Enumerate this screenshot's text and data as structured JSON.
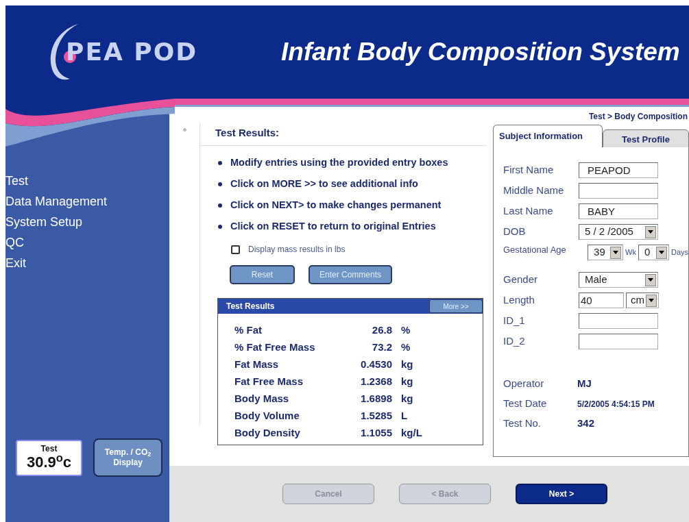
{
  "header": {
    "logo": "PEA POD",
    "title": "Infant Body Composition System"
  },
  "sidebar": {
    "items": [
      {
        "label": "Test",
        "selected": false
      },
      {
        "label": "Data Management",
        "selected": false
      },
      {
        "label": "System Setup",
        "selected": false
      },
      {
        "label": "QC",
        "selected": false
      },
      {
        "label": "Exit",
        "selected": false
      }
    ],
    "temperature": {
      "label": "Test",
      "value": "30.9$^{o}$c"
    },
    "display_button": [
      "Temp. / CO$_{2}$",
      "Display"
    ]
  },
  "breadcrumb": "Test > Body Composition",
  "section_title": "Test Results:",
  "instructions": [
    "Modify entries using the provided entry boxes",
    "Click on MORE >> to see additional info",
    "Click on NEXT> to make changes permanent",
    "Click on RESET to return to original Entries"
  ],
  "checkbox": {
    "label": "Display mass results in lbs",
    "checked": false
  },
  "action_buttons": [
    "Reset",
    "Enter Comments"
  ],
  "results": {
    "title": "Test Results",
    "more_button": "More >>",
    "rows": [
      {
        "label": "% Fat",
        "value": "26.8",
        "unit": "%"
      },
      {
        "label": "% Fat Free Mass",
        "value": "73.2",
        "unit": "%"
      },
      {
        "label": "Fat Mass",
        "value": "0.4530",
        "unit": "kg"
      },
      {
        "label": "Fat Free Mass",
        "value": "1.2368",
        "unit": "kg"
      },
      {
        "label": "Body Mass",
        "value": "1.6898",
        "unit": "kg"
      },
      {
        "label": "Body Volume",
        "value": "1.5285",
        "unit": "L"
      },
      {
        "label": "Body Density",
        "value": "1.1055",
        "unit": "kg/L"
      }
    ]
  },
  "tabs": [
    {
      "label": "Subject Information",
      "selected": true
    },
    {
      "label": "Test Profile",
      "selected": false
    }
  ],
  "fields": [
    {
      "kind": "text",
      "label": "First Name",
      "value": "PEAPOD"
    },
    {
      "kind": "text",
      "label": "Middle Name"
    },
    {
      "kind": "text",
      "label": "Last Name",
      "value": "BABY"
    },
    {
      "kind": "select",
      "label": "DOB",
      "value": "5 / 2 /2005"
    },
    {
      "kind": "age",
      "label": "Gestational Age",
      "weeks": "39",
      "weeks_unit": "Wk",
      "days": "0",
      "days_unit": "Days"
    },
    {
      "kind": "select",
      "label": "Gender",
      "value": "Male"
    },
    {
      "kind": "length",
      "label": "Length",
      "value": "40",
      "unit": "cm"
    },
    {
      "kind": "text",
      "label": "ID_1"
    },
    {
      "kind": "text",
      "label": "ID_2"
    }
  ],
  "info": [
    {
      "label": "Operator",
      "value": "MJ"
    },
    {
      "label": "Test Date",
      "value": "5/2/2005 4:54:15 PM"
    },
    {
      "label": "Test No.",
      "value": "342"
    }
  ],
  "footer_buttons": [
    {
      "label": "Cancel",
      "disabled": true
    },
    {
      "label": "< Back",
      "disabled": true
    },
    {
      "label": "Next >",
      "disabled": false
    }
  ]
}
